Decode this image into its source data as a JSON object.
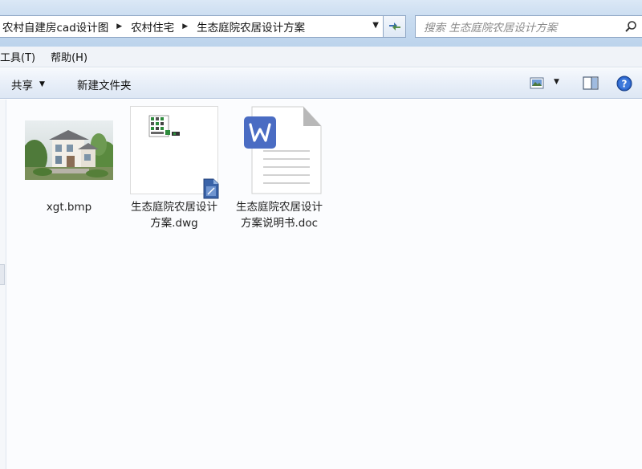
{
  "address_bar": {
    "crumbs": [
      "农村自建房cad设计图",
      "农村住宅",
      "生态庭院农居设计方案"
    ]
  },
  "search": {
    "placeholder": "搜索 生态庭院农居设计方案"
  },
  "menu": {
    "items": [
      "工具(T)",
      "帮助(H)"
    ]
  },
  "toolbar": {
    "share_label": "共享",
    "new_folder_label": "新建文件夹"
  },
  "files": [
    {
      "name": "xgt.bmp",
      "type": "bmp-image"
    },
    {
      "name": "生态庭院农居设计方案.dwg",
      "type": "dwg-drawing"
    },
    {
      "name": "生态庭院农居设计方案说明书.doc",
      "type": "wps-document"
    }
  ],
  "colors": {
    "wps_blue": "#4a6cc3",
    "chrome_blue": "#c9dcf0",
    "help_blue": "#2a62c8"
  }
}
